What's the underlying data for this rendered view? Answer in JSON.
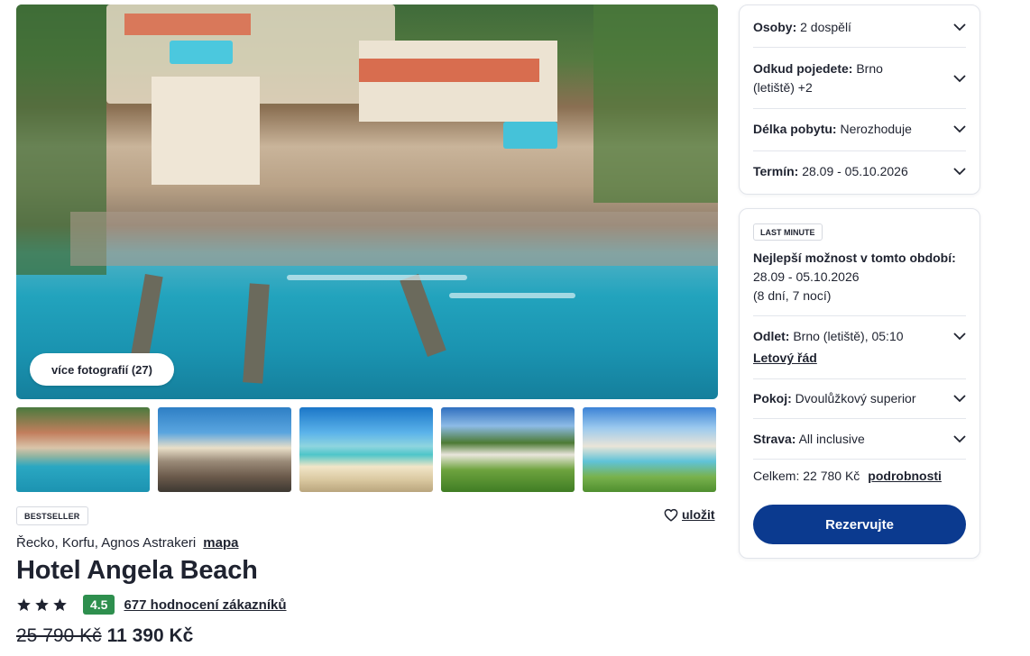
{
  "gallery": {
    "more_photos_label": "více fotografií (27)"
  },
  "hotel": {
    "badge": "BESTSELLER",
    "save_label": "uložit",
    "location": "Řecko, Korfu, Agnos Astrakeri",
    "map_label": "mapa",
    "name": "Hotel Angela Beach",
    "stars": 3,
    "score": "4.5",
    "reviews_label": "677 hodnocení zákazníků",
    "old_price": "25 790 Kč",
    "new_price": "11 390 Kč"
  },
  "filters": {
    "persons_label": "Osoby:",
    "persons_value": "2 dospělí",
    "departure_label": "Odkud pojedete:",
    "departure_value": "Brno",
    "departure_value2": "(letiště) +2",
    "length_label": "Délka pobytu:",
    "length_value": "Nerozhoduje",
    "term_label": "Termín:",
    "term_value": "28.09 - 05.10.2026"
  },
  "offer": {
    "badge": "LAST MINUTE",
    "best_title": "Nejlepší možnost v tomto období:",
    "best_dates": "28.09 - 05.10.2026",
    "best_nights": "(8 dní, 7 nocí)",
    "flight_label": "Odlet:",
    "flight_value": "Brno (letiště), 05:10",
    "timetable_label": "Letový řád",
    "room_label": "Pokoj:",
    "room_value": "Dvoulůžkový superior",
    "board_label": "Strava:",
    "board_value": "All inclusive",
    "total_label": "Celkem: 22 780 Kč",
    "details_label": "podrobnosti",
    "reserve_label": "Rezervujte"
  },
  "colors": {
    "accent": "#0b3a8f",
    "score_bg": "#2e8f4e"
  }
}
